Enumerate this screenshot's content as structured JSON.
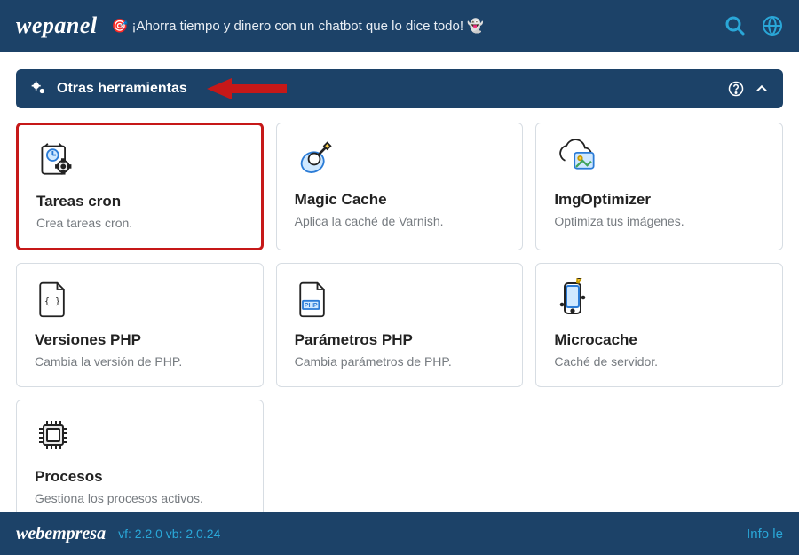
{
  "header": {
    "brand": "wepanel",
    "promo": "🎯 ¡Ahorra tiempo y dinero con un chatbot que lo dice todo! 👻"
  },
  "section": {
    "title": "Otras herramientas"
  },
  "cards": [
    {
      "title": "Tareas cron",
      "desc": "Crea tareas cron."
    },
    {
      "title": "Magic Cache",
      "desc": "Aplica la caché de Varnish."
    },
    {
      "title": "ImgOptimizer",
      "desc": "Optimiza tus imágenes."
    },
    {
      "title": "Versiones PHP",
      "desc": "Cambia la versión de PHP."
    },
    {
      "title": "Parámetros PHP",
      "desc": "Cambia parámetros de PHP."
    },
    {
      "title": "Microcache",
      "desc": "Caché de servidor."
    },
    {
      "title": "Procesos",
      "desc": "Gestiona los procesos activos."
    }
  ],
  "footer": {
    "brand": "webempresa",
    "version": "vf: 2.2.0 vb: 2.0.24",
    "info": "Info le"
  }
}
